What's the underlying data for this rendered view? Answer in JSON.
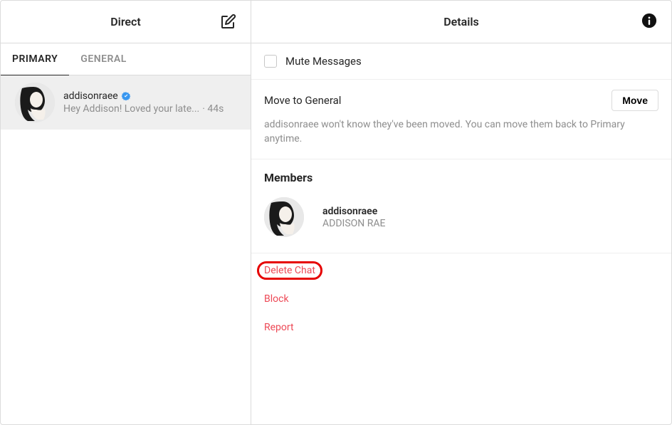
{
  "sidebar": {
    "title": "Direct",
    "tabs": [
      {
        "label": "PRIMARY",
        "active": true
      },
      {
        "label": "GENERAL",
        "active": false
      }
    ],
    "threads": [
      {
        "username": "addisonraee",
        "verified": true,
        "preview": "Hey Addison! Loved your late...",
        "time": "44s"
      }
    ]
  },
  "details": {
    "title": "Details",
    "mute_label": "Mute Messages",
    "move": {
      "title": "Move to General",
      "button": "Move",
      "description": "addisonraee won't know they've been moved. You can move them back to Primary anytime."
    },
    "members": {
      "heading": "Members",
      "list": [
        {
          "username": "addisonraee",
          "display": "ADDISON RAE"
        }
      ]
    },
    "actions": {
      "delete": "Delete Chat",
      "block": "Block",
      "report": "Report"
    }
  }
}
